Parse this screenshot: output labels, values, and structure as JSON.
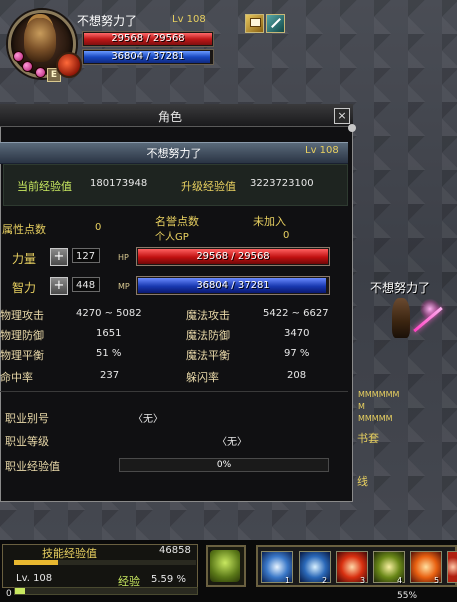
{
  "player": {
    "name": "不想努力了",
    "level": "Lv 108",
    "hp_text": "29568 / 29568",
    "mp_text": "36804 / 37281",
    "hp_ratio": 1.0,
    "mp_ratio": 0.987,
    "status_badge": "E"
  },
  "window": {
    "title": "角色",
    "close_label": "×",
    "name_row": {
      "name": "不想努力了",
      "level": "Lv 108"
    },
    "exp": {
      "current_label": "当前经验值",
      "current_value": "180173948",
      "next_label": "升级经验值",
      "next_value": "3223723100"
    },
    "attributes": {
      "points_label": "属性点数",
      "points_value": "0",
      "honor_label": "名誉点数",
      "pgp_label": "个人GP",
      "guild_label": "未加入",
      "guild_value": "0",
      "str_label": "力量",
      "str_value": "127",
      "int_label": "智力",
      "int_value": "448",
      "plus_label": "+",
      "hp_label": "HP",
      "mp_label": "MP",
      "hp_text": "29568 / 29568",
      "mp_text": "36804 / 37281",
      "hp_ratio": 1.0,
      "mp_ratio": 0.987
    },
    "combat": [
      {
        "name": "物理攻击",
        "value": "4270 ~ 5082"
      },
      {
        "name": "魔法攻击",
        "value": "5422 ~ 6627"
      },
      {
        "name": "物理防御",
        "value": "1651"
      },
      {
        "name": "魔法防御",
        "value": "3470"
      },
      {
        "name": "物理平衡",
        "value": "51 %"
      },
      {
        "name": "魔法平衡",
        "value": "97 %"
      },
      {
        "name": "命中率",
        "value": "237"
      },
      {
        "name": "躲闪率",
        "value": "208"
      }
    ],
    "job": {
      "name_label": "职业别号",
      "name_value": "〈无〉",
      "level_label": "职业等级",
      "level_value": "〈无〉",
      "exp_label": "职业经验值",
      "exp_text": "0%",
      "exp_ratio": 0
    }
  },
  "world": {
    "npc_name": "不想努力了",
    "chat_fragments": [
      "MMMMMM",
      "M",
      "MMMMM",
      "书套",
      "线"
    ]
  },
  "bottom": {
    "skill_exp_label": "技能经验值",
    "skill_exp_value": "46858",
    "skill_exp_ratio": 0.24,
    "level_text": "Lv. 108",
    "exp_label": "经验",
    "exp_pct": "5.59 %",
    "exp_ratio": 0.056,
    "bottom_digit": "0",
    "hotbar_numbers": [
      "1",
      "2",
      "3",
      "4",
      "5"
    ],
    "zoom_text": "55%"
  },
  "icons": [
    "shop-icon",
    "sword-buff-icon",
    "guild-emblem-icon",
    "pet-icon",
    "ice-arrow-skill-icon",
    "frost-skill-icon",
    "fire-skill-icon",
    "nature-skill-icon",
    "flame-skill-icon"
  ]
}
